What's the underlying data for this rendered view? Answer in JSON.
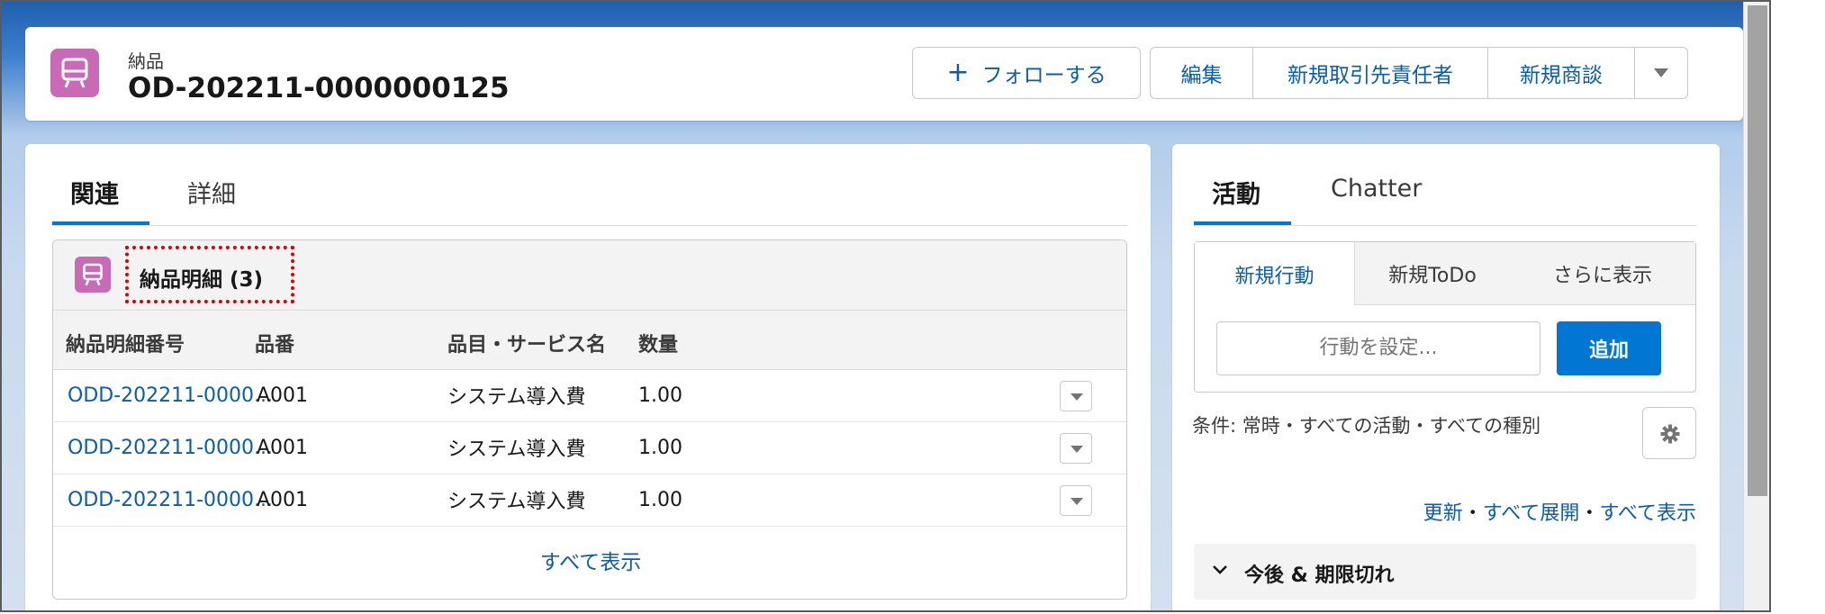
{
  "header": {
    "object_type": "納品",
    "record_name": "OD-202211-0000000125",
    "follow_label": "フォローする",
    "actions": [
      "編集",
      "新規取引先責任者",
      "新規商談"
    ],
    "more_icon": "chevron-down-icon"
  },
  "left": {
    "tabs": [
      "関連",
      "詳細"
    ],
    "related_list": {
      "title": "納品明細 (3)",
      "columns": [
        "納品明細番号",
        "品番",
        "品目・サービス名",
        "数量"
      ],
      "rows": [
        [
          "ODD-202211-0000...",
          "A001",
          "システム導入費",
          "1.00"
        ],
        [
          "ODD-202211-0000...",
          "A001",
          "システム導入費",
          "1.00"
        ],
        [
          "ODD-202211-0000...",
          "A001",
          "システム導入費",
          "1.00"
        ]
      ],
      "view_all": "すべて表示"
    }
  },
  "right": {
    "tabs": [
      "活動",
      "Chatter"
    ],
    "publisher_tabs": [
      "新規行動",
      "新規ToDo",
      "さらに表示"
    ],
    "input_placeholder": "行動を設定...",
    "add_label": "追加",
    "filter_text": "条件: 常時・すべての活動・すべての種別",
    "links": [
      "更新",
      "すべて展開",
      "すべて表示"
    ],
    "separator": "・",
    "upcoming_label": "今後 & 期限切れ"
  },
  "colors": {
    "brand_blue": "#0176d3",
    "link_blue": "#0b5cab",
    "object_icon": "#c86ab5",
    "highlight_red": "#e00000"
  }
}
